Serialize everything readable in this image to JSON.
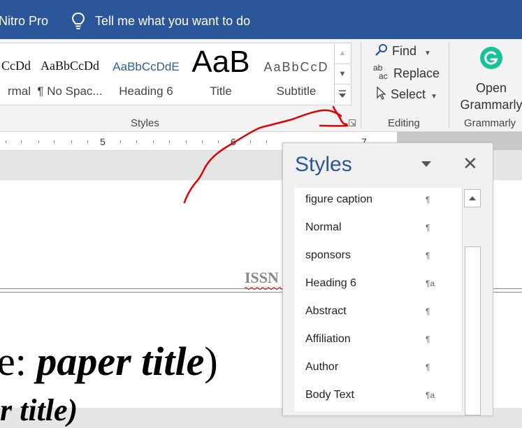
{
  "titlebar": {
    "app_fragment": "Nitro Pro",
    "tell_me": "Tell me what you want to do"
  },
  "styles_gallery": {
    "tiles": [
      {
        "preview": "CcDd",
        "name": "rmal"
      },
      {
        "preview": "AaBbCcDd",
        "name": "¶ No Spac..."
      },
      {
        "preview": "AaBbCcDdE",
        "name": "Heading 6"
      },
      {
        "preview": "AaB",
        "name": "Title"
      },
      {
        "preview": "AaBbCcD",
        "name": "Subtitle"
      }
    ],
    "group_label": "Styles"
  },
  "editing": {
    "find": "Find",
    "replace": "Replace",
    "replace_icon_top": "ab",
    "replace_icon_bottom": "ac",
    "select": "Select",
    "group_label": "Editing"
  },
  "grammarly": {
    "open_line1": "Open",
    "open_line2": "Grammarly",
    "group_label": "Grammarly",
    "brand_color": "#15c39a"
  },
  "ruler": {
    "labels": [
      "5",
      "6",
      "7"
    ]
  },
  "document": {
    "issn": "ISSN",
    "title_plain": "e: ",
    "title_italic": "paper title",
    "title_close": ")",
    "subtitle_fragment": "r title)"
  },
  "styles_pane": {
    "title": "Styles",
    "items": [
      {
        "label": "figure caption",
        "marker": "¶"
      },
      {
        "label": "Normal",
        "marker": "¶"
      },
      {
        "label": "sponsors",
        "marker": "¶"
      },
      {
        "label": "Heading 6",
        "marker": "¶a"
      },
      {
        "label": "Abstract",
        "marker": "¶"
      },
      {
        "label": "Affiliation",
        "marker": "¶"
      },
      {
        "label": "Author",
        "marker": "¶"
      },
      {
        "label": "Body Text",
        "marker": "¶a"
      }
    ]
  },
  "colors": {
    "titlebar": "#2b579a",
    "annotation": "#e00000"
  }
}
